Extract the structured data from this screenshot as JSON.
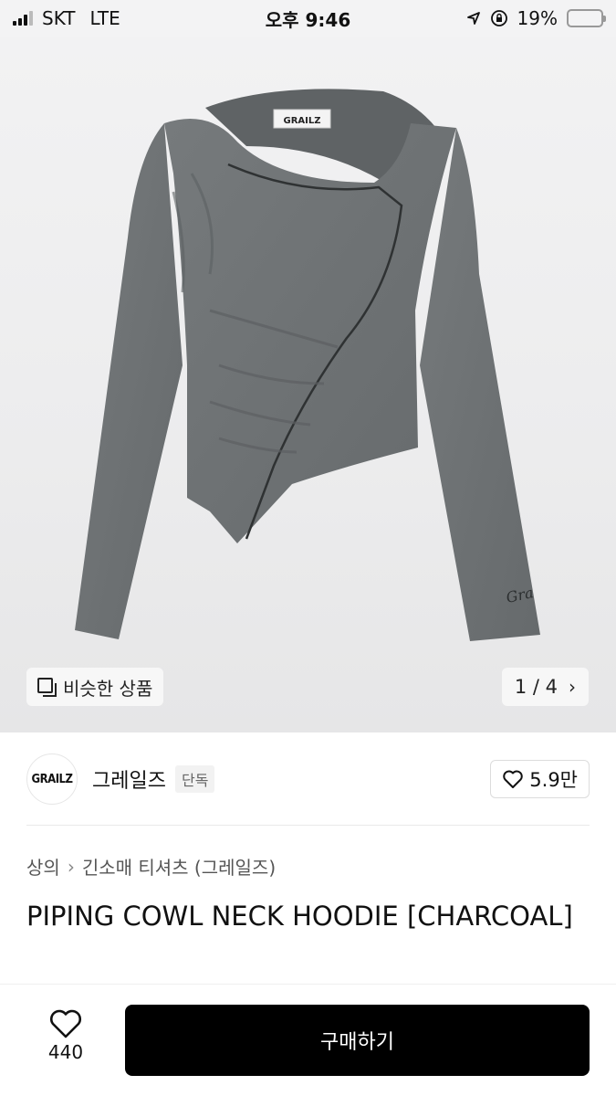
{
  "status_bar": {
    "carrier": "SKT",
    "network": "LTE",
    "time": "오후 9:46",
    "battery": "19%",
    "battery_level": 0.19,
    "icons": [
      "signal-icon",
      "location-arrow-icon",
      "orientation-lock-icon",
      "battery-icon"
    ]
  },
  "gallery": {
    "similar_label": "비슷한 상품",
    "pager": "1 / 4",
    "image_subject": "charcoal long-sleeve cowl neck hoodie",
    "tag_text": "GRAILZ",
    "sleeve_script": "Gra"
  },
  "brand": {
    "logo_text": "GRAILZ",
    "name": "그레일즈",
    "badge": "단독",
    "likes": "5.9만"
  },
  "breadcrumb": {
    "category": "상의",
    "subcategory": "긴소매 티셔츠 (그레일즈)"
  },
  "product": {
    "title": "PIPING COWL NECK HOODIE [CHARCOAL]"
  },
  "bottom_bar": {
    "wish_count": "440",
    "buy_label": "구매하기"
  },
  "colors": {
    "garment": "#6e7274",
    "buy_button": "#000000",
    "battery_fill": "#f5c518"
  }
}
